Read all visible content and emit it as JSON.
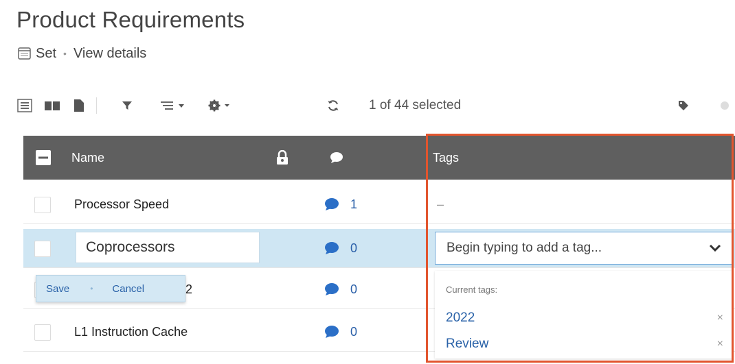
{
  "page": {
    "title": "Product Requirements",
    "set_label": "Set",
    "separator": "•",
    "view_details": "View details"
  },
  "toolbar": {
    "selection_count": "1",
    "selection_middle": "of",
    "selection_total": "44",
    "selection_suffix": "selected"
  },
  "table": {
    "columns": {
      "name": "Name",
      "tags": "Tags"
    },
    "rows": [
      {
        "name": "Processor Speed",
        "comments": "1",
        "tags": "–"
      },
      {
        "name": "Coprocessors",
        "comments": "0"
      },
      {
        "name_suffix": "2",
        "comments": "0"
      },
      {
        "name": "L1 Instruction Cache",
        "comments": "0"
      }
    ]
  },
  "editor": {
    "save": "Save",
    "dot": "•",
    "cancel": "Cancel"
  },
  "tags_editor": {
    "placeholder": "Begin typing to add a tag...",
    "current_label": "Current tags:",
    "tags": [
      "2022",
      "Review"
    ],
    "remove_symbol": "×"
  },
  "colors": {
    "header_bg": "#5f5f5f",
    "selected_row": "#cfe6f3",
    "link_blue": "#2a62a8",
    "comment_icon": "#2b6fc7",
    "highlight_border": "#e2552e"
  }
}
